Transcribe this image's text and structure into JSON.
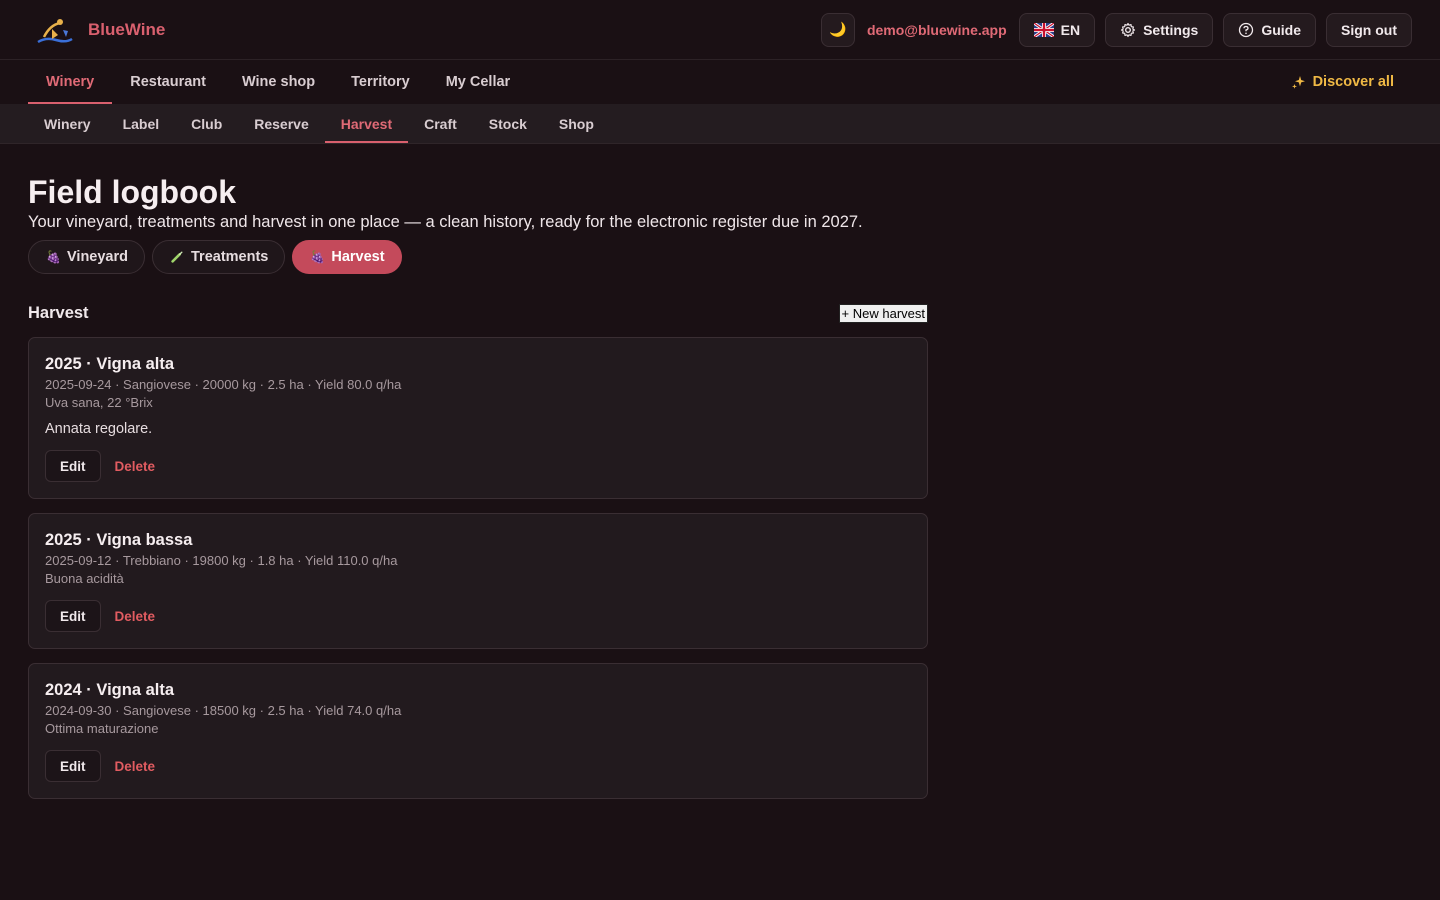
{
  "brand": {
    "name": "BlueWine"
  },
  "header": {
    "theme_icon": "moon-icon",
    "email": "demo@bluewine.app",
    "language": "EN",
    "settings_label": "Settings",
    "guide_label": "Guide",
    "signout_label": "Sign out"
  },
  "mainnav": {
    "tabs": [
      {
        "label": "Winery",
        "active": true
      },
      {
        "label": "Restaurant"
      },
      {
        "label": "Wine shop"
      },
      {
        "label": "Territory"
      },
      {
        "label": "My Cellar"
      }
    ],
    "discover_label": "Discover all"
  },
  "subnav": {
    "tabs": [
      {
        "label": "Winery"
      },
      {
        "label": "Label"
      },
      {
        "label": "Club"
      },
      {
        "label": "Reserve"
      },
      {
        "label": "Harvest",
        "active": true
      },
      {
        "label": "Craft"
      },
      {
        "label": "Stock"
      },
      {
        "label": "Shop"
      }
    ]
  },
  "page": {
    "title": "Field logbook",
    "subtitle": "Your vineyard, treatments and harvest in one place — a clean history, ready for the electronic register due in 2027.",
    "pills": [
      {
        "label": "Vineyard",
        "icon": "grapes-icon"
      },
      {
        "label": "Treatments",
        "icon": "syringe-icon"
      },
      {
        "label": "Harvest",
        "icon": "grapes-icon",
        "active": true
      }
    ]
  },
  "harvest": {
    "section_title": "Harvest",
    "new_label": "+ New harvest",
    "edit_label": "Edit",
    "delete_label": "Delete",
    "items": [
      {
        "title": "2025 · Vigna alta",
        "meta": "2025-09-24 · Sangiovese · 20000 kg · 2.5 ha · Yield 80.0 q/ha",
        "note": "Uva sana, 22 °Brix",
        "desc": "Annata regolare."
      },
      {
        "title": "2025 · Vigna bassa",
        "meta": "2025-09-12 · Trebbiano · 19800 kg · 1.8 ha · Yield 110.0 q/ha",
        "note": "Buona acidità",
        "desc": ""
      },
      {
        "title": "2024 · Vigna alta",
        "meta": "2024-09-30 · Sangiovese · 18500 kg · 2.5 ha · Yield 74.0 q/ha",
        "note": "Ottima maturazione",
        "desc": ""
      }
    ]
  },
  "colors": {
    "accent": "#d9606e",
    "active_pill": "#c44a5b",
    "discover": "#f0b945",
    "background": "#1a1014"
  }
}
